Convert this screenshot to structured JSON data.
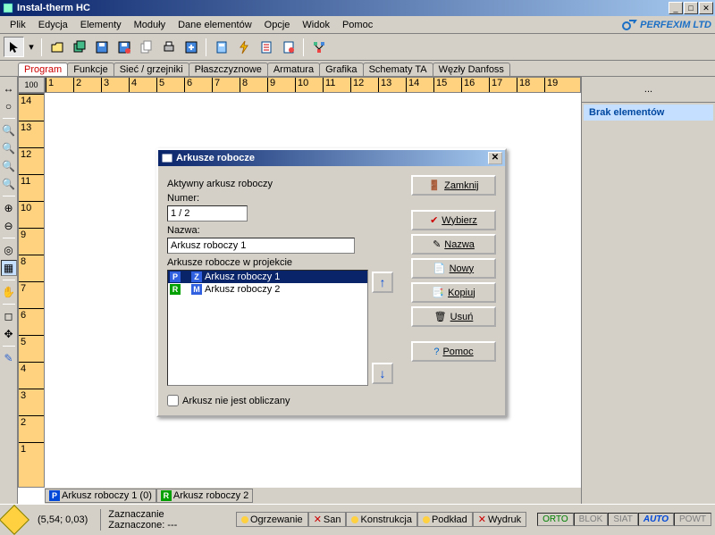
{
  "title": "Instal-therm HC",
  "menu": [
    "Plik",
    "Edycja",
    "Elementy",
    "Moduły",
    "Dane elementów",
    "Opcje",
    "Widok",
    "Pomoc"
  ],
  "logo": "PERFEXIM LTD",
  "tabs": [
    "Program",
    "Funkcje",
    "Sieć / grzejniki",
    "Płaszczyznowe",
    "Armatura",
    "Grafika",
    "Schematy TA",
    "Węzły Danfoss"
  ],
  "ruler_corner": "100",
  "ruler_h": [
    "1",
    "2",
    "3",
    "4",
    "5",
    "6",
    "7",
    "8",
    "9",
    "10",
    "11",
    "12",
    "13",
    "14",
    "15",
    "16",
    "17",
    "18",
    "19"
  ],
  "ruler_v": [
    "14",
    "13",
    "12",
    "11",
    "10",
    "9",
    "8",
    "7",
    "6",
    "5",
    "4",
    "3",
    "2",
    "1"
  ],
  "canvas_tabs": [
    {
      "badge": "P",
      "badge_class": "badge-p",
      "label": "Arkusz roboczy 1 (0)"
    },
    {
      "badge": "R",
      "badge_class": "badge-r",
      "label": "Arkusz roboczy 2"
    }
  ],
  "side": {
    "dots": "...",
    "msg": "Brak elementów"
  },
  "status": {
    "coords": "(5,54; 0,03)",
    "action": "Zaznaczanie",
    "selected": "Zaznaczone: ---",
    "tabs": [
      {
        "dot": "#ffd040",
        "label": "Ogrzewanie",
        "x": ""
      },
      {
        "dot": "",
        "label": "San",
        "x": "✕"
      },
      {
        "dot": "#ffd040",
        "label": "Konstrukcja",
        "x": ""
      },
      {
        "dot": "#ffd040",
        "label": "Podkład",
        "x": ""
      },
      {
        "dot": "",
        "label": "Wydruk",
        "x": "✕"
      }
    ],
    "modes": [
      "ORTO",
      "BLOK",
      "SIAT",
      "AUTO",
      "POWT"
    ]
  },
  "dialog": {
    "title": "Arkusze robocze",
    "active_label": "Aktywny arkusz roboczy",
    "number_label": "Numer:",
    "number_value": "1 / 2",
    "name_label": "Nazwa:",
    "name_value": "Arkusz roboczy 1",
    "list_label": "Arkusze robocze w projekcie",
    "items": [
      {
        "b1": "P",
        "c1": "#3060e0",
        "b2": "Z",
        "c2": "#3060e0",
        "label": "Arkusz roboczy 1",
        "sel": true
      },
      {
        "b1": "R",
        "c1": "#00a000",
        "b2": "M",
        "c2": "#3060e0",
        "label": "Arkusz roboczy 2",
        "sel": false
      }
    ],
    "check": "Arkusz nie jest obliczany",
    "buttons": {
      "close": "Zamknij",
      "choose": "Wybierz",
      "name": "Nazwa",
      "new": "Nowy",
      "copy": "Kopiuj",
      "delete": "Usuń",
      "help": "Pomoc"
    }
  }
}
